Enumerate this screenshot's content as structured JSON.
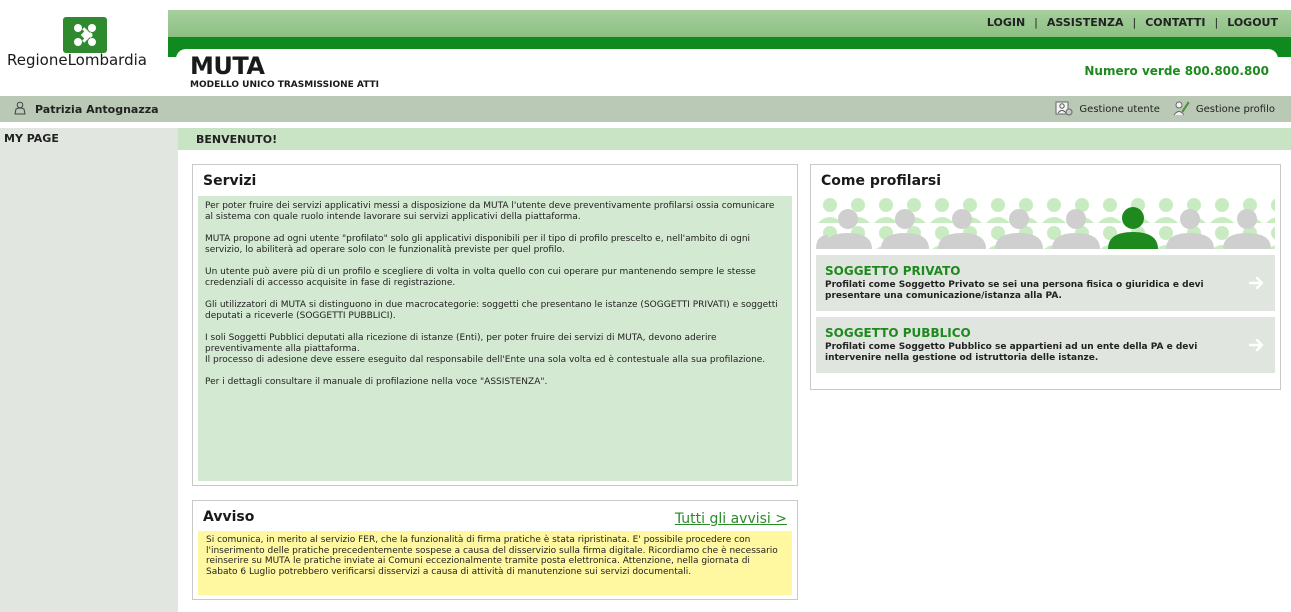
{
  "brand": {
    "logo_text": "RegioneLombardia"
  },
  "topnav": {
    "items": [
      "LOGIN",
      "ASSISTENZA",
      "CONTATTI",
      "LOGOUT"
    ],
    "separator": "|"
  },
  "header": {
    "title": "MUTA",
    "subtitle": "MODELLO UNICO TRASMISSIONE ATTI",
    "numero_verde": "Numero verde 800.800.800"
  },
  "userbar": {
    "user_name": "Patrizia Antognazza",
    "gestione_utente": "Gestione utente",
    "gestione_profilo": "Gestione profilo"
  },
  "sidebar": {
    "title": "MY PAGE"
  },
  "welcome": {
    "text": "BENVENUTO!"
  },
  "servizi": {
    "title": "Servizi",
    "paragraphs": [
      "Per poter fruire dei servizi applicativi messi a disposizione da MUTA l'utente deve preventivamente profilarsi ossia comunicare al sistema con quale ruolo intende lavorare sui servizi applicativi della piattaforma.",
      "MUTA propone ad ogni utente \"profilato\" solo gli applicativi disponibili per il tipo di profilo prescelto e, nell'ambito di ogni servizio, lo abiliterà ad operare solo con le funzionalità previste per quel profilo.",
      "Un utente può avere più di un profilo e scegliere di volta in volta quello con cui operare pur mantenendo sempre le stesse credenziali di accesso acquisite in fase di registrazione.",
      "Gli utilizzatori di MUTA si distinguono in due macrocategorie: soggetti che presentano le istanze (SOGGETTI PRIVATI) e soggetti deputati a riceverle (SOGGETTI PUBBLICI).",
      "I soli Soggetti Pubblici deputati alla ricezione di istanze (Enti), per poter fruire dei servizi di MUTA, devono aderire preventivamente alla piattaforma.",
      "Il processo di adesione deve essere eseguito dal responsabile dell'Ente una sola volta ed è contestuale alla sua profilazione.",
      "Per i dettagli consultare il manuale di profilazione nella voce \"ASSISTENZA\"."
    ]
  },
  "avviso": {
    "title": "Avviso",
    "link": "Tutti gli avvisi >",
    "text": "Si comunica, in merito al servizio FER, che la funzionalità di firma pratiche è stata ripristinata. E' possibile procedere con l'inserimento delle pratiche precedentemente sospese a causa del disservizio sulla firma digitale. Ricordiamo che è necessario reinserire su MUTA le pratiche inviate ai Comuni eccezionalmente tramite posta elettronica. Attenzione, nella giornata di Sabato 6 Luglio potrebbero verificarsi disservizi a causa di attività di manutenzione sui servizi documentali."
  },
  "profilarsi": {
    "title": "Come profilarsi",
    "cards": [
      {
        "title": "SOGGETTO PRIVATO",
        "desc": "Profilati come Soggetto Privato se sei una persona fisica o giuridica e devi presentare una comunicazione/istanza alla PA."
      },
      {
        "title": "SOGGETTO PUBBLICO",
        "desc": "Profilati come Soggetto Pubblico se appartieni ad un ente della PA e devi intervenire nella gestione od istruttoria delle istanze."
      }
    ]
  },
  "colors": {
    "brand_green": "#0e8a1e",
    "light_green": "#d4e9d2",
    "notice_yellow": "#fff8a0"
  }
}
